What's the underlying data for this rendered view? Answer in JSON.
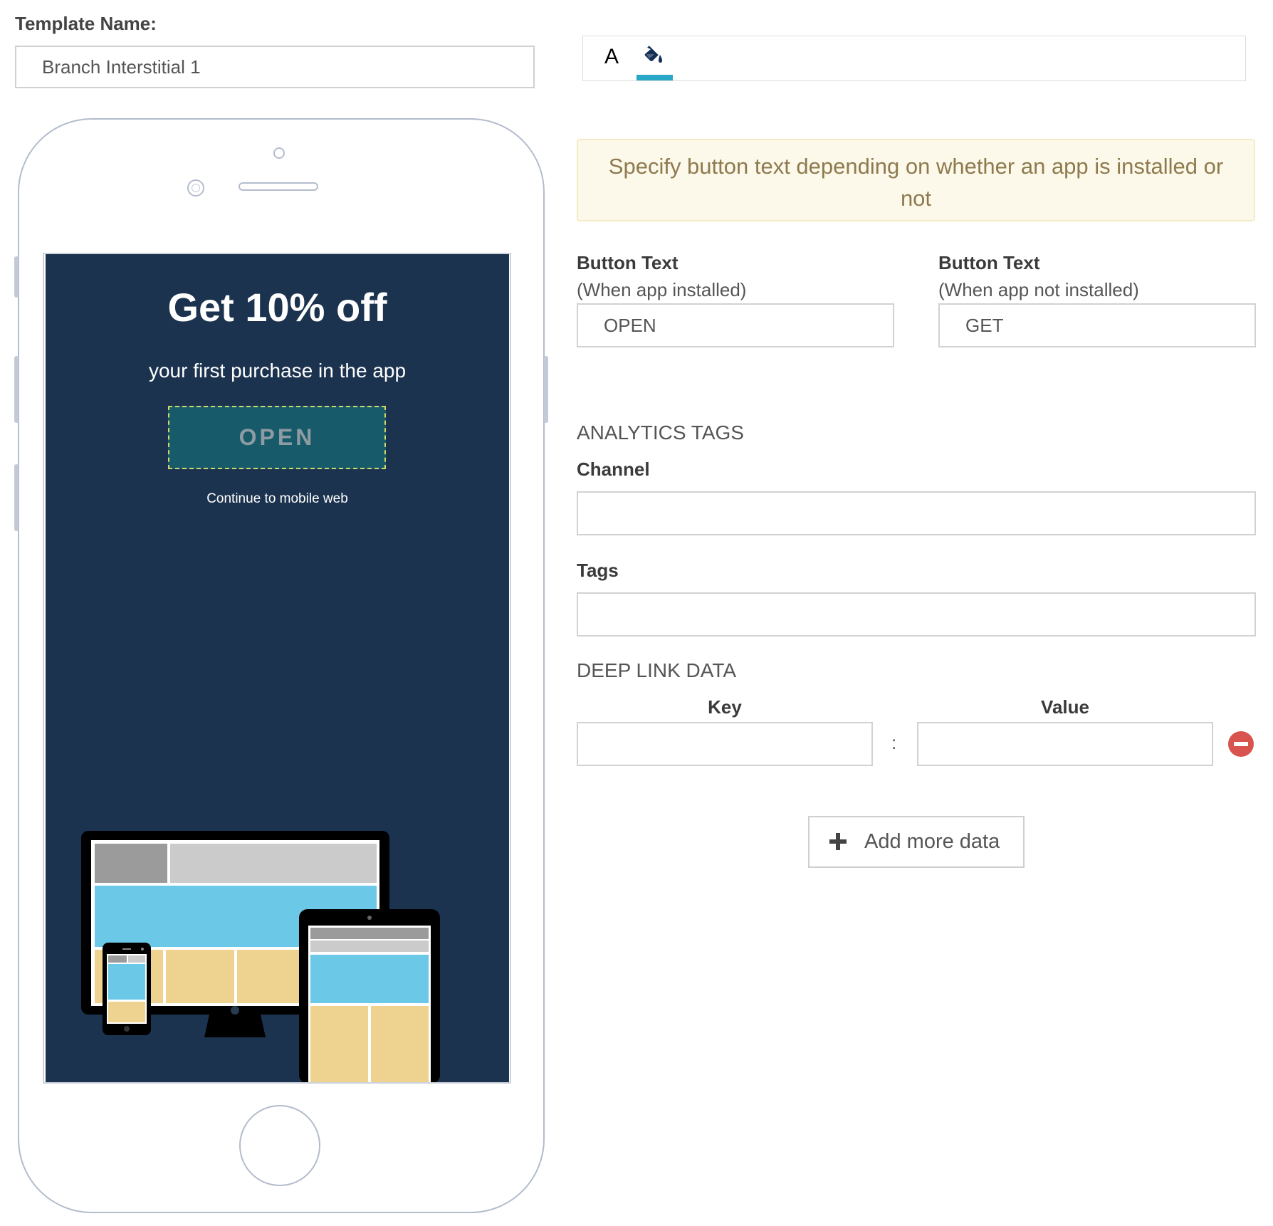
{
  "template": {
    "label": "Template Name:",
    "name_value": "Branch Interstitial 1"
  },
  "toolbar": {
    "text_tool_glyph": "A",
    "active_tool": "paint-bucket",
    "accent_color": "#28a7c6"
  },
  "preview": {
    "background_color": "#1c334f",
    "headline": "Get 10% off",
    "subline": "your first purchase in the app",
    "button_label": "OPEN",
    "continue_link": "Continue to mobile web"
  },
  "alert": {
    "text": "Specify button text depending on whether an app is installed or not"
  },
  "button_text": {
    "installed": {
      "label": "Button Text",
      "sublabel": "(When app installed)",
      "value": "OPEN"
    },
    "not_installed": {
      "label": "Button Text",
      "sublabel": "(When app not installed)",
      "value": "GET"
    }
  },
  "analytics": {
    "heading": "ANALYTICS TAGS",
    "channel_label": "Channel",
    "channel_value": "",
    "tags_label": "Tags",
    "tags_value": ""
  },
  "deep_link": {
    "heading": "DEEP LINK DATA",
    "key_header": "Key",
    "value_header": "Value",
    "separator": ":",
    "rows": [
      {
        "key": "",
        "value": ""
      }
    ],
    "add_label": "Add more data"
  }
}
